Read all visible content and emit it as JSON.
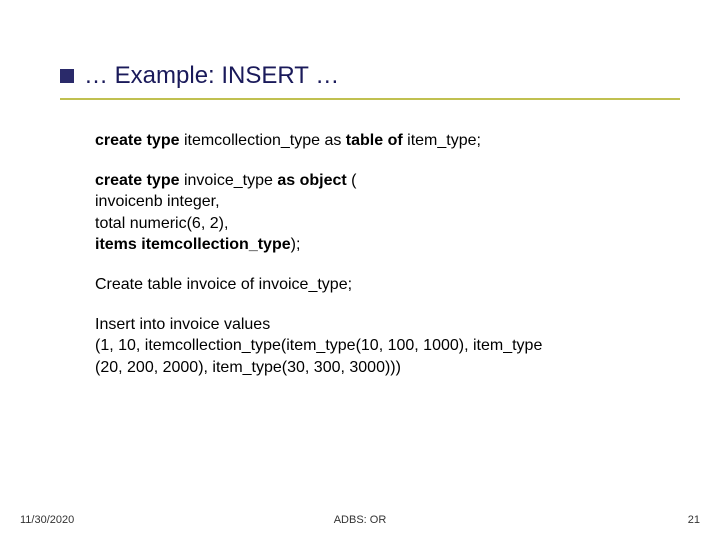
{
  "title": "… Example: INSERT …",
  "blocks": {
    "b1_l1_pre": "create type ",
    "b1_l1_mid": "itemcollection_type as ",
    "b1_l1_post": "table of ",
    "b1_l1_end": "item_type;",
    "b2_l1_pre": "create type ",
    "b2_l1_mid": "invoice_type ",
    "b2_l1_post": "as object ",
    "b2_l1_end": "(",
    "b2_l2": "invoicenb integer,",
    "b2_l3": "total numeric(6, 2),",
    "b2_l4_pre": "items itemcollection_type",
    "b2_l4_end": ");",
    "b3": "Create table invoice of invoice_type;",
    "b4_l1": "Insert into invoice values",
    "b4_l2": "(1, 10, itemcollection_type(item_type(10, 100, 1000), item_type",
    "b4_l3": "(20, 200, 2000), item_type(30, 300, 3000)))"
  },
  "footer": {
    "date": "11/30/2020",
    "center": "ADBS: OR",
    "page": "21"
  }
}
